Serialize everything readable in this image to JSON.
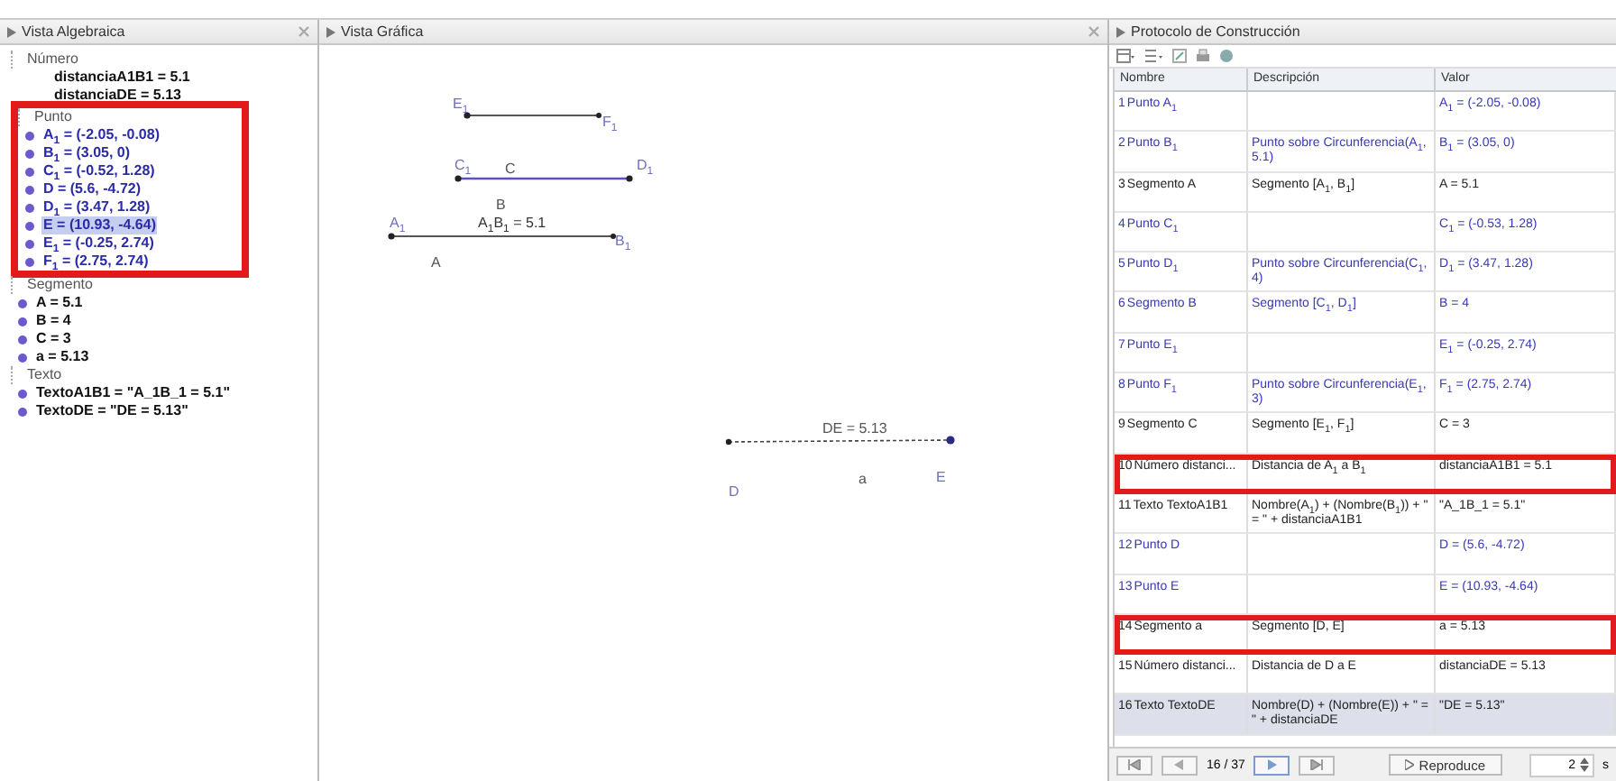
{
  "algebra": {
    "title": "Vista Algebraica",
    "groups": [
      {
        "label": "Número",
        "highlighted": false,
        "items": [
          {
            "text": "distanciaA1B1 = 5.1",
            "shown": false,
            "selected": false
          },
          {
            "text": "distanciaDE = 5.13",
            "shown": false,
            "selected": false
          }
        ]
      },
      {
        "label": "Punto",
        "highlighted": true,
        "items": [
          {
            "text": "A$_{1}$ = (-2.05, -0.08)",
            "shown": true,
            "selected": false
          },
          {
            "text": "B$_{1}$ = (3.05, 0)",
            "shown": true,
            "selected": false
          },
          {
            "text": "C$_{1}$ = (-0.52, 1.28)",
            "shown": true,
            "selected": false
          },
          {
            "text": "D = (5.6, -4.72)",
            "shown": true,
            "selected": false
          },
          {
            "text": "D$_{1}$ = (3.47, 1.28)",
            "shown": true,
            "selected": false
          },
          {
            "text": "E = (10.93, -4.64)",
            "shown": true,
            "selected": true
          },
          {
            "text": "E$_{1}$ = (-0.25, 2.74)",
            "shown": true,
            "selected": false
          },
          {
            "text": "F$_{1}$ = (2.75, 2.74)",
            "shown": true,
            "selected": false
          }
        ]
      },
      {
        "label": "Segmento",
        "highlighted": false,
        "items": [
          {
            "text": "A = 5.1",
            "shown": true,
            "selected": false
          },
          {
            "text": "B = 4",
            "shown": true,
            "selected": false
          },
          {
            "text": "C = 3",
            "shown": true,
            "selected": false
          },
          {
            "text": "a = 5.13",
            "shown": true,
            "selected": false
          }
        ]
      },
      {
        "label": "Texto",
        "highlighted": false,
        "items": [
          {
            "text": "TextoA1B1 = \"A_1B_1 = 5.1\"",
            "shown": true,
            "selected": false
          },
          {
            "text": "TextoDE = \"DE = 5.13\"",
            "shown": true,
            "selected": false
          }
        ]
      }
    ]
  },
  "graphics": {
    "title": "Vista Gráfica",
    "labels": [
      "E$_{1}$",
      "F$_{1}$",
      "C$_{1}$",
      "C",
      "D$_{1}$",
      "B",
      "A$_{1}$",
      "A$_{1}$B$_{1}$ = 5.1",
      "B$_{1}$",
      "A",
      "DE = 5.13",
      "D",
      "a",
      "E"
    ]
  },
  "protocol": {
    "title": "Protocolo de Construcción",
    "columns": [
      "Nombre",
      "Descripción",
      "Valor"
    ],
    "rows": [
      {
        "number": "1",
        "name": "Punto A$_{1}$",
        "description": "",
        "value": "A$_{1}$ = (-2.05, -0.08)",
        "independent": true,
        "highlighted": false,
        "selected": false
      },
      {
        "number": "2",
        "name": "Punto B$_{1}$",
        "description": "Punto sobre Circunferencia(A$_{1}$, 5.1)",
        "value": "B$_{1}$ = (3.05, 0)",
        "independent": true,
        "highlighted": false,
        "selected": false
      },
      {
        "number": "3",
        "name": "Segmento A",
        "description": "Segmento [A$_{1}$, B$_{1}$]",
        "value": "A = 5.1",
        "independent": false,
        "highlighted": false,
        "selected": false
      },
      {
        "number": "4",
        "name": "Punto C$_{1}$",
        "description": "",
        "value": "C$_{1}$ = (-0.53, 1.28)",
        "independent": true,
        "highlighted": false,
        "selected": false
      },
      {
        "number": "5",
        "name": "Punto D$_{1}$",
        "description": "Punto sobre Circunferencia(C$_{1}$, 4)",
        "value": "D$_{1}$ = (3.47, 1.28)",
        "independent": true,
        "highlighted": false,
        "selected": false
      },
      {
        "number": "6",
        "name": "Segmento B",
        "description": "Segmento [C$_{1}$, D$_{1}$]",
        "value": "B = 4",
        "independent": true,
        "highlighted": false,
        "selected": false
      },
      {
        "number": "7",
        "name": "Punto E$_{1}$",
        "description": "",
        "value": "E$_{1}$ = (-0.25, 2.74)",
        "independent": true,
        "highlighted": false,
        "selected": false
      },
      {
        "number": "8",
        "name": "Punto F$_{1}$",
        "description": "Punto sobre Circunferencia(E$_{1}$, 3)",
        "value": "F$_{1}$ = (2.75, 2.74)",
        "independent": true,
        "highlighted": false,
        "selected": false
      },
      {
        "number": "9",
        "name": "Segmento C",
        "description": "Segmento [E$_{1}$, F$_{1}$]",
        "value": "C = 3",
        "independent": false,
        "highlighted": false,
        "selected": false
      },
      {
        "number": "10",
        "name": "Número distanci...",
        "description": "Distancia de A$_{1}$ a B$_{1}$",
        "value": "distanciaA1B1 = 5.1",
        "independent": false,
        "highlighted": true,
        "selected": false
      },
      {
        "number": "11",
        "name": "Texto TextoA1B1",
        "description": "Nombre(A$_{1}$) + (Nombre(B$_{1}$)) + \" = \" + distanciaA1B1",
        "value": "\"A_1B_1 = 5.1\"",
        "independent": false,
        "highlighted": false,
        "selected": false
      },
      {
        "number": "12",
        "name": "Punto D",
        "description": "",
        "value": "D = (5.6, -4.72)",
        "independent": true,
        "highlighted": false,
        "selected": false
      },
      {
        "number": "13",
        "name": "Punto E",
        "description": "",
        "value": "E = (10.93, -4.64)",
        "independent": true,
        "highlighted": false,
        "selected": false
      },
      {
        "number": "14",
        "name": "Segmento a",
        "description": "Segmento [D, E]",
        "value": "a = 5.13",
        "independent": false,
        "highlighted": true,
        "selected": false
      },
      {
        "number": "15",
        "name": "Número distanci...",
        "description": "Distancia de D a E",
        "value": "distanciaDE = 5.13",
        "independent": false,
        "highlighted": false,
        "selected": false
      },
      {
        "number": "16",
        "name": "Texto TextoDE",
        "description": "Nombre(D) + (Nombre(E)) + \" = \" + distanciaDE",
        "value": "\"DE = 5.13\"",
        "independent": false,
        "highlighted": false,
        "selected": true
      }
    ],
    "navigation": {
      "position": "16 / 37",
      "play": "Reproduce",
      "delay": "2",
      "unit": "s"
    }
  }
}
